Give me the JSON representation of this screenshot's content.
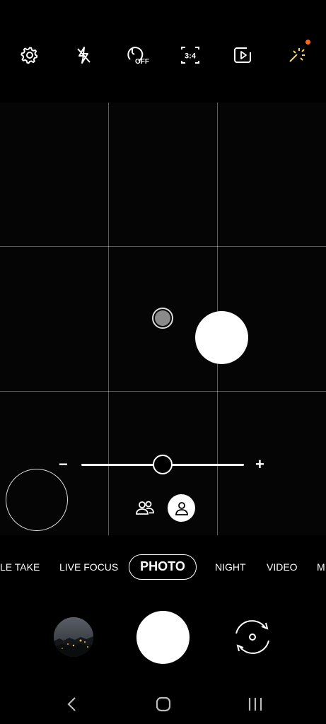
{
  "top_bar": {
    "items": [
      {
        "icon": "settings-icon"
      },
      {
        "icon": "flash-off-icon"
      },
      {
        "icon": "timer-icon",
        "label": "OFF"
      },
      {
        "icon": "aspect-ratio-icon",
        "label": "3:4"
      },
      {
        "icon": "motion-photo-icon"
      },
      {
        "icon": "filters-icon",
        "badge_color": "#f26a21"
      }
    ]
  },
  "zoom": {
    "minus": "−",
    "plus": "+"
  },
  "portrait_options": {
    "group": "group-icon",
    "single": "person-icon"
  },
  "modes": {
    "items": [
      "LE TAKE",
      "LIVE FOCUS",
      "PHOTO",
      "NIGHT",
      "VIDEO",
      "M"
    ],
    "active": "PHOTO"
  },
  "controls": {
    "gallery": "gallery-thumbnail",
    "shutter": "shutter-button",
    "switch": "switch-camera-icon"
  },
  "nav": {
    "back": "back-icon",
    "home": "home-icon",
    "recents": "recents-icon"
  },
  "colors": {
    "background": "#000000",
    "accent": "#f26a21",
    "foreground": "#ffffff"
  }
}
